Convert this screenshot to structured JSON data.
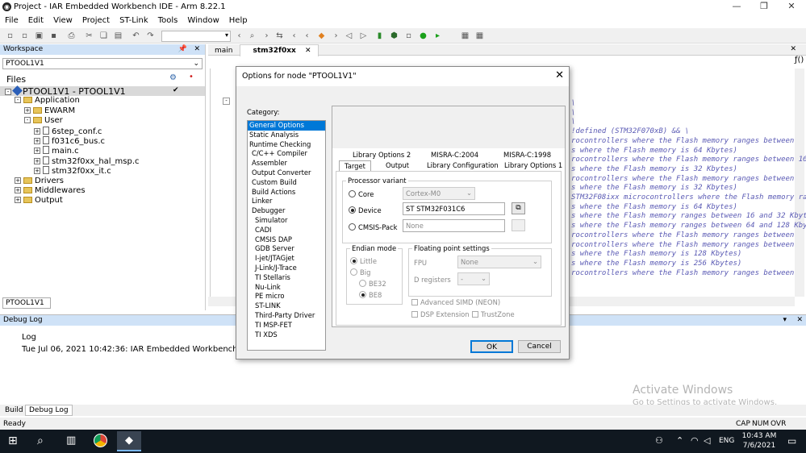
{
  "app": {
    "title": "Project - IAR Embedded Workbench IDE - Arm 8.22.1"
  },
  "menu": [
    "File",
    "Edit",
    "View",
    "Project",
    "ST-Link",
    "Tools",
    "Window",
    "Help"
  ],
  "workspace": {
    "title": "Workspace",
    "config": "PTOOL1V1",
    "files_label": "Files",
    "tree": [
      {
        "label": "PTOOL1V1 - PTOOL1V1",
        "level": 0,
        "kind": "project",
        "exp": "-",
        "bold": true
      },
      {
        "label": "Application",
        "level": 1,
        "kind": "folder",
        "exp": "-"
      },
      {
        "label": "EWARM",
        "level": 2,
        "kind": "folder",
        "exp": "+"
      },
      {
        "label": "User",
        "level": 2,
        "kind": "folder",
        "exp": "-"
      },
      {
        "label": "6step_conf.c",
        "level": 3,
        "kind": "file",
        "exp": "+"
      },
      {
        "label": "f031c6_bus.c",
        "level": 3,
        "kind": "file",
        "exp": "+"
      },
      {
        "label": "main.c",
        "level": 3,
        "kind": "file",
        "exp": "+"
      },
      {
        "label": "stm32f0xx_hal_msp.c",
        "level": 3,
        "kind": "file",
        "exp": "+"
      },
      {
        "label": "stm32f0xx_it.c",
        "level": 3,
        "kind": "file",
        "exp": "+"
      },
      {
        "label": "Drivers",
        "level": 1,
        "kind": "folder",
        "exp": "+"
      },
      {
        "label": "Middlewares",
        "level": 1,
        "kind": "folder",
        "exp": "+"
      },
      {
        "label": "Output",
        "level": 1,
        "kind": "folder",
        "exp": "+"
      }
    ],
    "bottom_tab": "PTOOL1V1"
  },
  "editor": {
    "tabs": [
      "main",
      "stm32f0xx"
    ],
    "code_lines": [
      "\\",
      "\\",
      "\\",
      "!defined (STM32F070xB) && \\",
      "rocontrollers where the Flash memory ranges between",
      "s where the Flash memory is 64 Kbytes)",
      "rocontrollers where the Flash memory ranges between 16",
      "s where the Flash memory is 32 Kbytes)",
      "rocontrollers where the Flash memory ranges between",
      "s where the Flash memory is 32 Kbytes)",
      "STM32F08ixx microcontrollers where the Flash memory ranges",
      "s where the Flash memory is 64 Kbytes)",
      "s where the Flash memory ranges between 16 and 32 Kbyt",
      "s where the Flash memory ranges between 64 and 128 Kby",
      "rocontrollers where the Flash memory ranges between",
      "rocontrollers where the Flash memory ranges between",
      "s where the Flash memory is 128 Kbytes)",
      "s where the Flash memory is 256 Kbytes)",
      "rocontrollers where the Flash memory ranges between"
    ]
  },
  "debug": {
    "title": "Debug Log",
    "log_header": "Log",
    "log_line": "Tue Jul 06, 2021 10:42:36: IAR Embedded Workbench 8.22.1 (",
    "tabs": [
      "Build",
      "Debug Log"
    ],
    "watermark_title": "Activate Windows",
    "watermark_sub": "Go to Settings to activate Windows."
  },
  "status": {
    "left": "Ready",
    "indicators": [
      "CAP",
      "NUM",
      "OVR"
    ]
  },
  "taskbar": {
    "time": "10:43 AM",
    "date": "7/6/2021",
    "lang": "ENG"
  },
  "dialog": {
    "title": "Options for node \"PTOOL1V1\"",
    "category_label": "Category:",
    "categories": [
      {
        "label": "General Options",
        "sel": true,
        "ind": false
      },
      {
        "label": "Static Analysis",
        "ind": false
      },
      {
        "label": "Runtime Checking",
        "ind": false
      },
      {
        "label": "C/C++ Compiler",
        "ind": true
      },
      {
        "label": "Assembler",
        "ind": true
      },
      {
        "label": "Output Converter",
        "ind": true
      },
      {
        "label": "Custom Build",
        "ind": true
      },
      {
        "label": "Build Actions",
        "ind": true
      },
      {
        "label": "Linker",
        "ind": true
      },
      {
        "label": "Debugger",
        "ind": true
      },
      {
        "label": "Simulator",
        "ind": true,
        "deep": true
      },
      {
        "label": "CADI",
        "ind": true,
        "deep": true
      },
      {
        "label": "CMSIS DAP",
        "ind": true,
        "deep": true
      },
      {
        "label": "GDB Server",
        "ind": true,
        "deep": true
      },
      {
        "label": "I-jet/JTAGjet",
        "ind": true,
        "deep": true
      },
      {
        "label": "J-Link/J-Trace",
        "ind": true,
        "deep": true
      },
      {
        "label": "TI Stellaris",
        "ind": true,
        "deep": true
      },
      {
        "label": "Nu-Link",
        "ind": true,
        "deep": true
      },
      {
        "label": "PE micro",
        "ind": true,
        "deep": true
      },
      {
        "label": "ST-LINK",
        "ind": true,
        "deep": true
      },
      {
        "label": "Third-Party Driver",
        "ind": true,
        "deep": true
      },
      {
        "label": "TI MSP-FET",
        "ind": true,
        "deep": true
      },
      {
        "label": "TI XDS",
        "ind": true,
        "deep": true
      }
    ],
    "tabs_row1": [
      "Library Options 2",
      "MISRA-C:2004",
      "MISRA-C:1998"
    ],
    "tabs_row2": [
      "Target",
      "Output",
      "Library Configuration",
      "Library Options 1"
    ],
    "processor": {
      "group": "Processor variant",
      "core_label": "Core",
      "core_value": "Cortex-M0",
      "device_label": "Device",
      "device_value": "ST STM32F031C6",
      "cmsis_label": "CMSIS-Pack",
      "cmsis_value": "None"
    },
    "endian": {
      "group": "Endian mode",
      "little": "Little",
      "big": "Big",
      "be32": "BE32",
      "be8": "BE8"
    },
    "fp": {
      "group": "Floating point settings",
      "fpu_label": "FPU",
      "fpu_value": "None",
      "dreg_label": "D registers",
      "dreg_value": "-",
      "simd": "Advanced SIMD (NEON)",
      "dsp": "DSP Extension",
      "trustzone": "TrustZone"
    },
    "ok": "OK",
    "cancel": "Cancel"
  }
}
